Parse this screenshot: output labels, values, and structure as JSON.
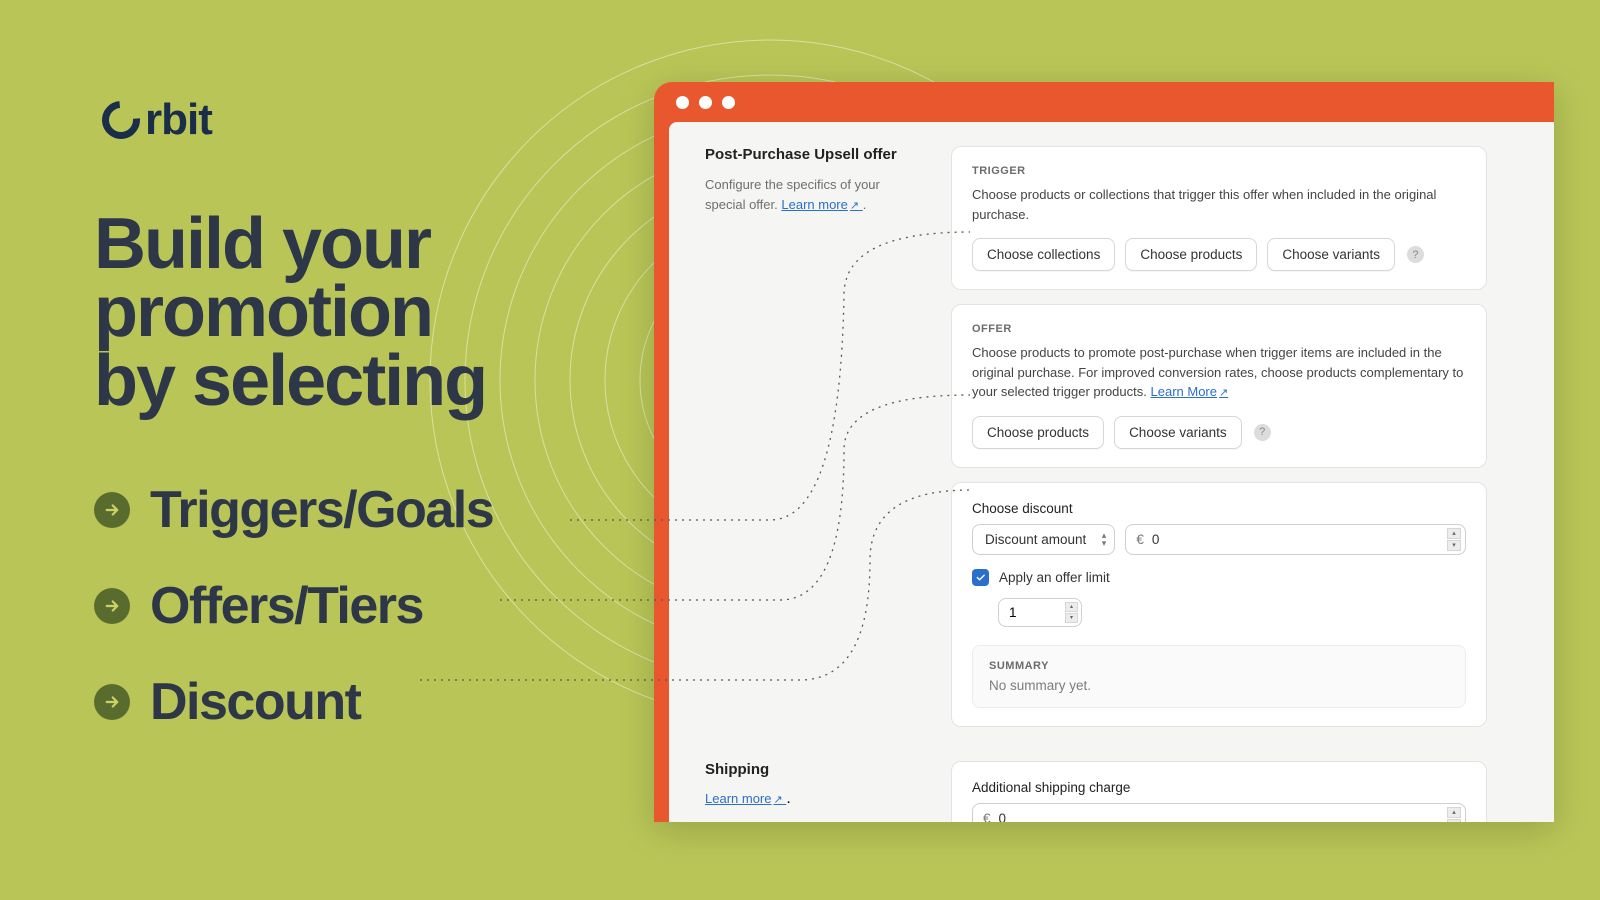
{
  "brand": "rbit",
  "headline_1": "Build your",
  "headline_2": "promotion",
  "headline_3": "by selecting",
  "bullets": [
    "Triggers/Goals",
    "Offers/Tiers",
    "Discount"
  ],
  "upsell": {
    "title": "Post-Purchase Upsell offer",
    "desc": "Configure the specifics of your special offer.",
    "learn": "Learn more"
  },
  "trigger": {
    "label": "TRIGGER",
    "desc": "Choose products or collections that trigger this offer when included in the original purchase.",
    "btn_collections": "Choose collections",
    "btn_products": "Choose products",
    "btn_variants": "Choose variants"
  },
  "offer": {
    "label": "OFFER",
    "desc": "Choose products to promote post-purchase when trigger items are included in the original purchase. For improved conversion rates, choose products complementary to your selected trigger products.",
    "learn": "Learn More",
    "btn_products": "Choose products",
    "btn_variants": "Choose variants"
  },
  "discount": {
    "label": "Choose discount",
    "select": "Discount amount",
    "currency": "€",
    "value": "0",
    "limit_label": "Apply an offer limit",
    "limit_value": "1"
  },
  "summary": {
    "label": "SUMMARY",
    "text": "No summary yet."
  },
  "shipping": {
    "title": "Shipping",
    "learn": "Learn more",
    "charge_label": "Additional shipping charge",
    "currency": "€",
    "value": "0"
  }
}
